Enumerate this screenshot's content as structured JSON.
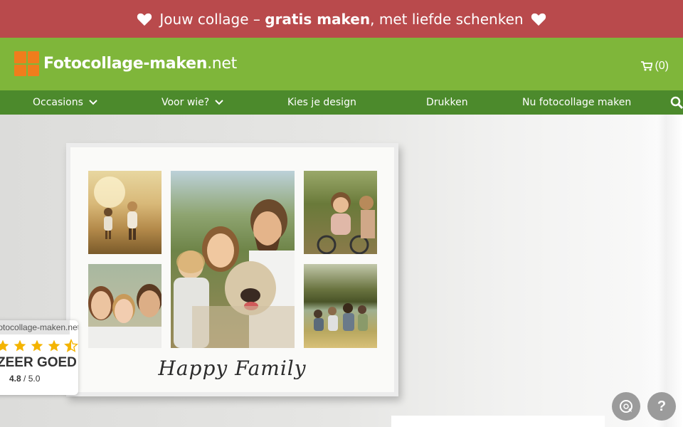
{
  "promo": {
    "text_before": "Jouw collage – ",
    "text_bold": "gratis maken",
    "text_after": ", met liefde schenken"
  },
  "header": {
    "logo_name": "Fotocollage-maken",
    "logo_tld": ".net",
    "cart_label": "(0)"
  },
  "nav": {
    "items": [
      "Occasions",
      "Voor wie?",
      "Kies je design",
      "Drukken",
      "Nu fotocollage maken"
    ]
  },
  "hero": {
    "caption": "Happy Family"
  },
  "rating": {
    "site": "fotocollage-maken.net",
    "verdict": "ZEER GOED",
    "score": "4.8",
    "max": "/ 5.0",
    "stars_value": 4.5
  },
  "help": {
    "label": "?"
  },
  "colors": {
    "promo": "#b94a4c",
    "header": "#7fb63a",
    "nav": "#4c8a2c",
    "logo": "#f07d1c",
    "star": "#f4b400"
  }
}
